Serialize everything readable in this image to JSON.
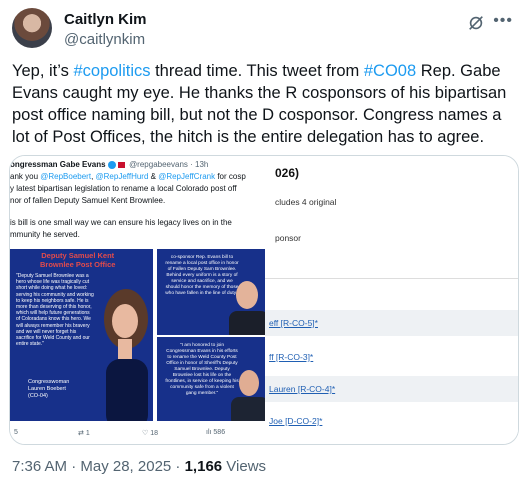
{
  "author": {
    "name": "Caitlyn Kim",
    "handle": "@caitlynkim"
  },
  "tweet": {
    "text_parts": [
      {
        "text": "Yep, it’s ",
        "hashtag": false
      },
      {
        "text": "#copolitics",
        "hashtag": true
      },
      {
        "text": " thread time. This tweet from ",
        "hashtag": false
      },
      {
        "text": "#CO08",
        "hashtag": true
      },
      {
        "text": " Rep. Gabe Evans caught my eye. He thanks the R cosponsors of his bipartisan post office naming bill, but not the D cosponsor. Congress names a lot of Post Offices, the hitch is the entire delegation has to agree.",
        "hashtag": false
      }
    ],
    "timestamp": "7:36 AM · May 28, 2025 · ",
    "views_count": "1,166",
    "views_label": " Views"
  },
  "icons": {
    "grok": "grok-icon",
    "more": "more-icon",
    "hashtag_color": "#1d9bf0"
  },
  "media": {
    "inner_tweet": {
      "author": "ongressman Gabe Evans",
      "handle_time": "@repgabeevans · 13h",
      "line1_prefix": "ank you ",
      "mention1": "@RepBoebert",
      "line1_sep": ", ",
      "mention2": "@RepJeffHurd",
      "line1_amp": " & ",
      "mention3": "@RepJeffCrank",
      "line1_suffix": " for cosp",
      "line2": "y latest bipartisan legislation to rename a local Colorado post off",
      "line3": "nor of fallen Deputy Samuel Kent Brownlee.",
      "line4": "is bill is one small way we can ensure his legacy lives on in the",
      "line5": "mmunity he served.",
      "left_panel_title_1": "Deputy Samuel Kent",
      "left_panel_title_2": "Brownlee Post Office",
      "left_panel_body": "\"Deputy Samuel Brownlee was a hero whose life was tragically cut short while doing what he loved: serving his community and working to keep his neighbors safe. He is more than deserving of this honor, which will help future generations of Coloradans know this hero. We will always remember his bravery and we will never forget his sacrifice for Weld County and our entire state.\"",
      "left_panel_sig_1": "Congresswoman",
      "left_panel_sig_2": "Lauren Boebert",
      "left_panel_sig_3": "(CO-04)",
      "right_top_text": "co-sponsor Rep. Evans bill to rename a local post office in honor of Fallen Deputy Sam Brownlee. Behind every uniform is a story of service and sacrifice, and we should honor the memory of those who have fallen in the line of duty.\"",
      "right_bottom_text": "\"I am honored to join Congressman Evans in his efforts to rename the Weld County Post Office in honor of Sheriff's Deputy Samuel Brownlee. Deputy Brownlee lost his life on the frontlines, in service of keeping his community safe from a violent gang member.\"",
      "actions": {
        "replies": "5",
        "reposts": "1",
        "likes": "18",
        "views": "586"
      }
    },
    "congress_panel": {
      "title": "026)",
      "includes": "cludes 4 original",
      "cosponsor_label": "ponsor",
      "cosponsors": [
        "eff [R-CO-5]*",
        "ff [R-CO-3]*",
        " Lauren [R-CO-4]*",
        " Joe [D-CO-2]*"
      ]
    }
  }
}
